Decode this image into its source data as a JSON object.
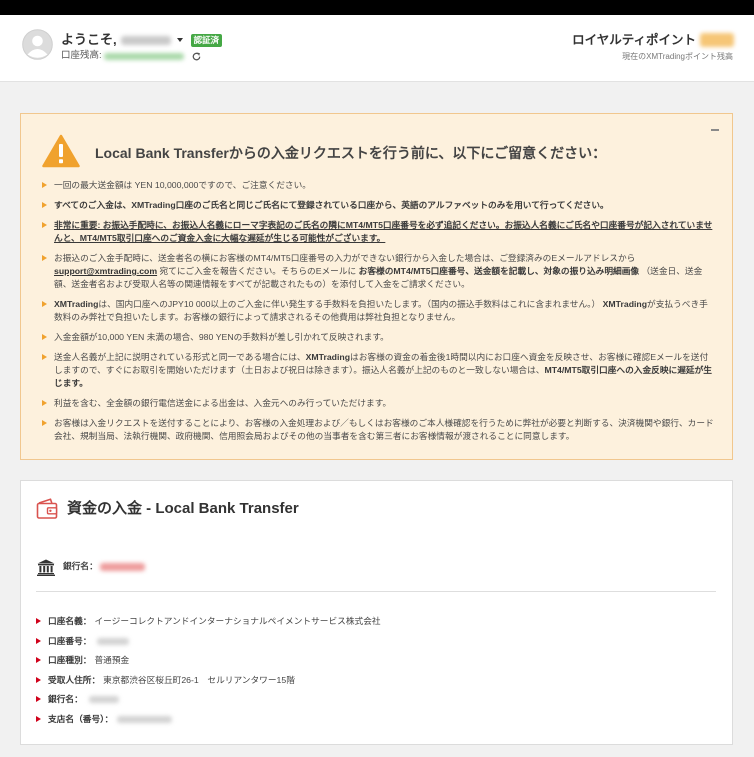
{
  "header": {
    "welcome_label": "ようこそ,",
    "verified_badge": "認証済",
    "balance_label": "口座残高:",
    "loyalty_title": "ロイヤルティポイント",
    "loyalty_subtitle": "現在のXMTradingポイント残高"
  },
  "notice": {
    "title": "Local Bank Transferからの入金リクエストを行う前に、以下にご留意ください：",
    "items": [
      {
        "segments": [
          {
            "text": "一回の最大送金額は YEN 10,000,000ですので、ご注意ください。"
          }
        ]
      },
      {
        "segments": [
          {
            "text": "すべてのご入金は、XMTrading口座のご氏名と同じご氏名にて登録されている口座から、英語のアルファベットのみを用いて行ってください。",
            "bold": true
          }
        ]
      },
      {
        "segments": [
          {
            "text": "非常に重要: お振込手配時に、お振込人名義にローマ字表記のご氏名の隣にMT4/MT5口座番号を必ず追記ください。お振込人名義にご氏名や口座番号が記入されていませんと、MT4/MT5取引口座へのご資金入金に大幅な遅延が生じる可能性がございます。",
            "bold": true,
            "underline": true
          }
        ]
      },
      {
        "segments": [
          {
            "text": "お振込のご入金手配時に、送金者名の横にお客様のMT4/MT5口座番号の入力ができない銀行から入金した場合は、ご登録済みのEメールアドレスから "
          },
          {
            "text": "support@xmtrading.com",
            "link": true
          },
          {
            "text": " 宛てにご入金を報告ください。そちらのEメールに "
          },
          {
            "text": "お客様のMT4/MT5口座番号、送金額を記載し、対象の振り込み明細画像",
            "bold": true
          },
          {
            "text": " （送金日、送金額、送金者名および受取人名等の関連情報をすべてが記載されたもの）を添付して入金をご請求ください。"
          }
        ]
      },
      {
        "segments": [
          {
            "text": "XMTrading",
            "bold": true
          },
          {
            "text": "は、国内口座へのJPY10 000以上のご入金に伴い発生する手数料を負担いたします。（国内の振込手数料はこれに含まれません。） "
          },
          {
            "text": "XMTrading",
            "bold": true
          },
          {
            "text": "が支払うべき手数料のみ弊社で負担いたします。お客様の銀行によって請求されるその他費用は弊社負担となりません。"
          }
        ]
      },
      {
        "segments": [
          {
            "text": "入金金額が10,000 YEN 未満の場合、980 YENの手数料が差し引かれて反映されます。"
          }
        ]
      },
      {
        "segments": [
          {
            "text": "送金人名義が上記に説明されている形式と同一である場合には、"
          },
          {
            "text": "XMTrading",
            "bold": true
          },
          {
            "text": "はお客様の資金の着金後1時間以内にお口座へ資金を反映させ、お客様に確認Eメールを送付しますので、すぐにお取引を開始いただけます（土日および祝日は除きます）。振込人名義が上記のものと一致しない場合は、"
          },
          {
            "text": "MT4/MT5取引口座への入金反映に遅延が生じます。",
            "bold": true
          }
        ]
      },
      {
        "segments": [
          {
            "text": "利益を含む、全金額の銀行電信送金による出金は、入金元へのみ行っていただけます。"
          }
        ]
      },
      {
        "segments": [
          {
            "text": "お客様は入金リクエストを送付することにより、お客様の入金処理および／もしくはお客様のご本人様確認を行うために弊社が必要と判断する、決済機関や銀行、カード会社、規制当局、法執行機関、政府機関、信用照会局およびその他の当事者を含む第三者にお客様情報が渡されることに同意します。"
          }
        ]
      }
    ]
  },
  "deposit": {
    "title": "資金の入金 - Local Bank Transfer",
    "bank_label": "銀行名：",
    "details": [
      {
        "label": "口座名義：",
        "value": "イージーコレクトアンドインターナショナルペイメントサービス株式会社"
      },
      {
        "label": "口座番号："
      },
      {
        "label": "口座種別：",
        "value": "普通預金"
      },
      {
        "label": "受取人住所：",
        "value": "東京都渋谷区桜丘町26-1　セルリアンタワー15階"
      },
      {
        "label": "銀行名："
      },
      {
        "label": "支店名（番号）："
      }
    ]
  },
  "icons": {
    "avatar": "user-avatar-icon",
    "menu_caret": "caret-down-icon",
    "refresh": "refresh-icon",
    "warning": "warning-triangle-icon",
    "collapse": "minus-icon",
    "bullet": "triangle-right-icon",
    "deposit": "wallet-icon",
    "bank": "bank-building-icon"
  },
  "colors": {
    "top_bar": "#000000",
    "page_background": "#f1f1f1",
    "verified_green": "#45a845",
    "notice_background": "#fdf1dd",
    "notice_border": "#f1c78e",
    "warning_orange": "#f0a22e",
    "detail_marker_red": "#d0021b",
    "deposit_icon_red": "#d9534f",
    "text": "#444444"
  }
}
